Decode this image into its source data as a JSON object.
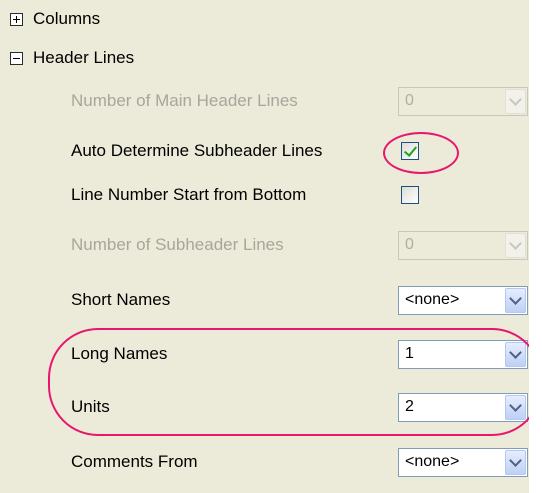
{
  "tree": {
    "columns_label": "Columns",
    "header_lines_label": "Header Lines"
  },
  "rows": [
    {
      "label": "Number of Main Header Lines",
      "value": "0",
      "disabled": true
    },
    {
      "label": "Auto Determine Subheader Lines",
      "checked": true
    },
    {
      "label": "Line Number Start from Bottom",
      "checked": false
    },
    {
      "label": "Number of Subheader Lines",
      "value": "0",
      "disabled": true
    },
    {
      "label": "Short Names",
      "value": "<none>"
    },
    {
      "label": "Long Names",
      "value": "1"
    },
    {
      "label": "Units",
      "value": "2"
    },
    {
      "label": "Comments From",
      "value": "<none>"
    }
  ],
  "colors": {
    "panel_bg": "#ecebd9",
    "annotation": "#e8166f",
    "checkmark": "#21a121"
  },
  "icons": {
    "collapsed_expander": "plus-box-icon",
    "expanded_expander": "minus-box-icon",
    "dropdown": "chevron-down-icon"
  }
}
